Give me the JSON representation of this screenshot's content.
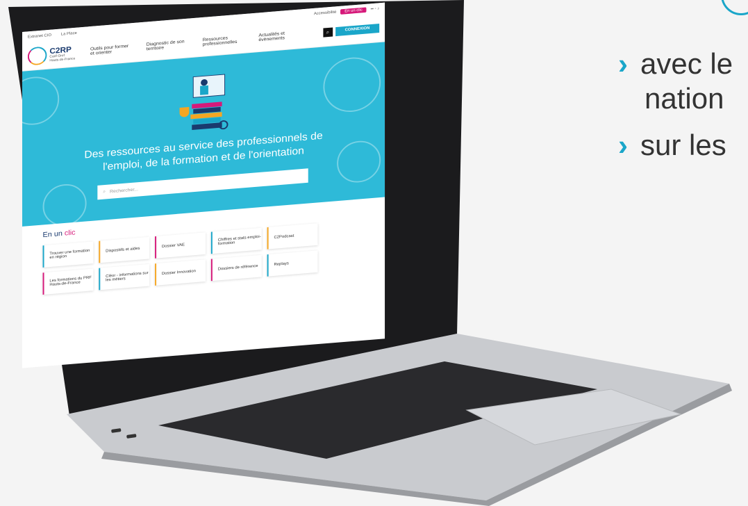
{
  "slide": {
    "bullet1_line1": "avec le",
    "bullet1_line2": "nation",
    "bullet2": "sur les"
  },
  "colors": {
    "accent": "#1aa6c9",
    "pink": "#d6197a",
    "orange": "#f5a623"
  },
  "site": {
    "topbar": {
      "left": [
        "Extranet CIO",
        "La Place"
      ],
      "accessibility": "Accessibilité",
      "en_un_clic": "En un clic"
    },
    "logo": {
      "name": "C2RP",
      "sub": "Carif-Oref",
      "region": "Hauts-de-France"
    },
    "nav": [
      "Outils pour former et orienter",
      "Diagnostic de son territoire",
      "Ressources professionnelles",
      "Actualités et évènements"
    ],
    "login": "CONNEXION",
    "hero_title_line1": "Des ressources au service des professionnels de",
    "hero_title_line2": "l'emploi, de la formation et de l'orientation",
    "search_placeholder": "Rechercher...",
    "clic_title_a": "En un",
    "clic_title_b": "clic",
    "tiles": [
      "Trouver une formation en région",
      "Dispositifs et aides",
      "Dossier VAE",
      "Chiffres et stats emploi-formation",
      "C2Podcast",
      "Les formations du PRF Hauts-de-France",
      "Cléor - informations sur les métiers",
      "Dossier Innovation",
      "Dossiers de référence",
      "Replays"
    ]
  }
}
